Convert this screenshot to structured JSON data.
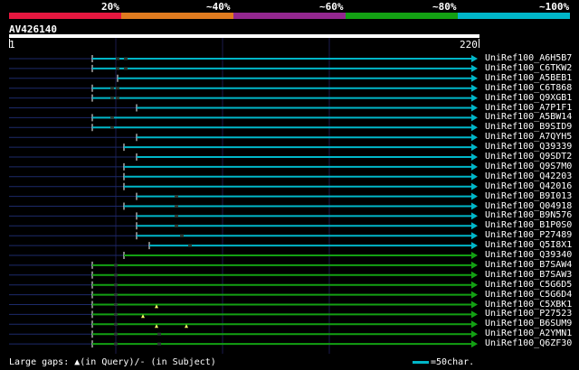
{
  "legend": {
    "labels": [
      "20%",
      "~40%",
      "~60%",
      "~80%",
      "~100%"
    ],
    "colors": [
      "#e5173f",
      "#e07b1f",
      "#93278f",
      "#13a013",
      "#00b6c8"
    ]
  },
  "query": {
    "name": "AV426140",
    "start": "1",
    "end": "220"
  },
  "hits": [
    {
      "name": "UniRef100_A6H5B7",
      "color": "#00b6c8"
    },
    {
      "name": "UniRef100_C6TKW2",
      "color": "#00b6c8"
    },
    {
      "name": "UniRef100_A5BEB1",
      "color": "#00b6c8"
    },
    {
      "name": "UniRef100_C6T868",
      "color": "#00b6c8"
    },
    {
      "name": "UniRef100_Q9XGB1",
      "color": "#00b6c8"
    },
    {
      "name": "UniRef100_A7P1F1",
      "color": "#00b6c8"
    },
    {
      "name": "UniRef100_A5BW14",
      "color": "#00b6c8"
    },
    {
      "name": "UniRef100_B9SID9",
      "color": "#00b6c8"
    },
    {
      "name": "UniRef100_A7QYH5",
      "color": "#00b6c8"
    },
    {
      "name": "UniRef100_Q39339",
      "color": "#00b6c8"
    },
    {
      "name": "UniRef100_Q9SDT2",
      "color": "#00b6c8"
    },
    {
      "name": "UniRef100_Q9S7M0",
      "color": "#00b6c8"
    },
    {
      "name": "UniRef100_Q42203",
      "color": "#00b6c8"
    },
    {
      "name": "UniRef100_Q42016",
      "color": "#00b6c8"
    },
    {
      "name": "UniRef100_B9I013",
      "color": "#00b6c8"
    },
    {
      "name": "UniRef100_Q04918",
      "color": "#00b6c8"
    },
    {
      "name": "UniRef100_B9N576",
      "color": "#00b6c8"
    },
    {
      "name": "UniRef100_B1P0S0",
      "color": "#00b6c8"
    },
    {
      "name": "UniRef100_P27489",
      "color": "#00b6c8"
    },
    {
      "name": "UniRef100_Q5I8X1",
      "color": "#00b6c8"
    },
    {
      "name": "UniRef100_Q39340",
      "color": "#13a013"
    },
    {
      "name": "UniRef100_B7SAW4",
      "color": "#13a013"
    },
    {
      "name": "UniRef100_B7SAW3",
      "color": "#13a013"
    },
    {
      "name": "UniRef100_C5G6D5",
      "color": "#13a013"
    },
    {
      "name": "UniRef100_C5G6D4",
      "color": "#13a013"
    },
    {
      "name": "UniRef100_C5XBK1",
      "color": "#13a013"
    },
    {
      "name": "UniRef100_P27523",
      "color": "#13a013"
    },
    {
      "name": "UniRef100_B6SUM9",
      "color": "#13a013"
    },
    {
      "name": "UniRef100_A2YMN1",
      "color": "#13a013"
    },
    {
      "name": "UniRef100_Q6ZF30",
      "color": "#13a013"
    }
  ],
  "footer": {
    "text": "Large gaps: ▲(in Query)/‐ (in Subject)"
  },
  "scale": {
    "text": "=50char."
  }
}
